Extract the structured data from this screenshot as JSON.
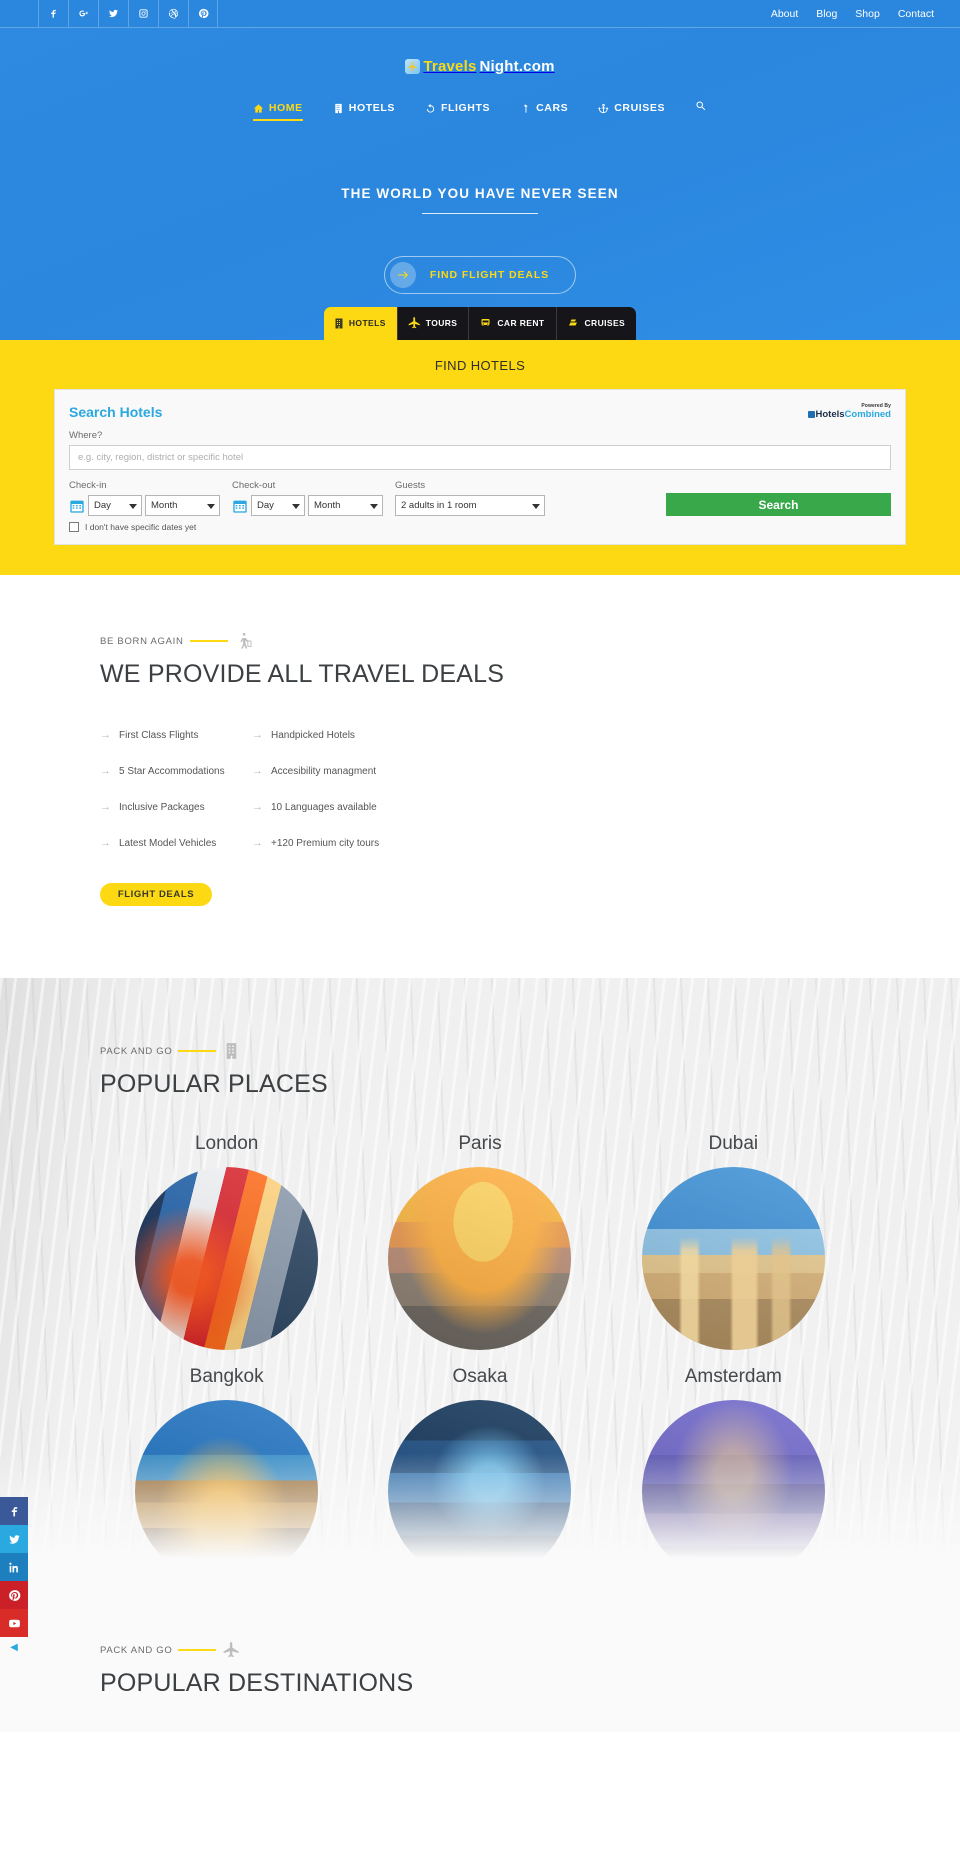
{
  "topbar": {
    "social": [
      {
        "name": "facebook-icon",
        "label": "Facebook"
      },
      {
        "name": "google-plus-icon",
        "label": "Google Plus"
      },
      {
        "name": "twitter-icon",
        "label": "Twitter"
      },
      {
        "name": "instagram-icon",
        "label": "Instagram"
      },
      {
        "name": "dribbble-icon",
        "label": "Dribbble"
      },
      {
        "name": "pinterest-icon",
        "label": "Pinterest"
      }
    ],
    "links": [
      "About",
      "Blog",
      "Shop",
      "Contact"
    ]
  },
  "brand": {
    "part1": "Travels",
    "part2": "Night.com"
  },
  "nav": [
    {
      "label": "HOME",
      "icon": "home-icon",
      "active": true
    },
    {
      "label": "HOTELS",
      "icon": "building-icon",
      "active": false
    },
    {
      "label": "FLIGHTS",
      "icon": "refresh-icon",
      "active": false
    },
    {
      "label": "CARS",
      "icon": "car-turn-icon",
      "active": false
    },
    {
      "label": "CRUISES",
      "icon": "anchor-icon",
      "active": false
    }
  ],
  "hero": {
    "title": "THE WORLD YOU HAVE NEVER SEEN",
    "cta_label": "FIND FLIGHT DEALS"
  },
  "tabs": [
    {
      "label": "HOTELS",
      "icon": "hotel-building-icon",
      "active": true
    },
    {
      "label": "TOURS",
      "icon": "plane-icon",
      "active": false
    },
    {
      "label": "CAR RENT",
      "icon": "bus-icon",
      "active": false
    },
    {
      "label": "CRUISES",
      "icon": "boat-icon",
      "active": false
    }
  ],
  "search_panel": {
    "band_title": "FIND HOTELS",
    "form_title": "Search Hotels",
    "powered_by": "Powered By",
    "provider_a": "Hotels",
    "provider_b": "Combined",
    "where_label": "Where?",
    "where_placeholder": "e.g. city, region, district or specific hotel",
    "checkin_label": "Check-in",
    "checkout_label": "Check-out",
    "guests_label": "Guests",
    "day_value": "Day",
    "month_value": "Month",
    "guests_value": "2 adults in 1 room",
    "search_label": "Search",
    "no_dates_label": "I don't have specific dates yet"
  },
  "deals": {
    "eyebrow": "BE BORN AGAIN",
    "eyebrow_icon": "walking-traveler-icon",
    "heading": "WE PROVIDE ALL TRAVEL DEALS",
    "features_left": [
      "First Class Flights",
      "5 Star Accommodations",
      "Inclusive Packages",
      "Latest Model Vehicles"
    ],
    "features_right": [
      "Handpicked Hotels",
      "Accesibility managment",
      "10 Languages available",
      "+120 Premium city tours"
    ],
    "arrow": "→",
    "button_label": "FLIGHT DEALS"
  },
  "places": {
    "eyebrow": "PACK AND GO",
    "eyebrow_icon": "building-icon",
    "heading": "POPULAR PLACES",
    "items": [
      {
        "name": "London",
        "img": "img-london"
      },
      {
        "name": "Paris",
        "img": "img-paris"
      },
      {
        "name": "Dubai",
        "img": "img-dubai"
      },
      {
        "name": "Bangkok",
        "img": "img-bangkok"
      },
      {
        "name": "Osaka",
        "img": "img-osaka"
      },
      {
        "name": "Amsterdam",
        "img": "img-amsterdam"
      }
    ]
  },
  "destinations": {
    "eyebrow": "PACK AND GO",
    "eyebrow_icon": "plane-icon",
    "heading": "POPULAR DESTINATIONS"
  },
  "rail": [
    {
      "name": "facebook-icon",
      "cls": "fb"
    },
    {
      "name": "twitter-icon",
      "cls": "tw"
    },
    {
      "name": "linkedin-icon",
      "cls": "li"
    },
    {
      "name": "pinterest-icon",
      "cls": "pi"
    },
    {
      "name": "youtube-icon",
      "cls": "yt"
    }
  ],
  "colors": {
    "hero_blue": "#2b86dd",
    "accent_yellow": "#fcd913",
    "search_green": "#39a84b",
    "link_blue": "#2aa8e0"
  }
}
